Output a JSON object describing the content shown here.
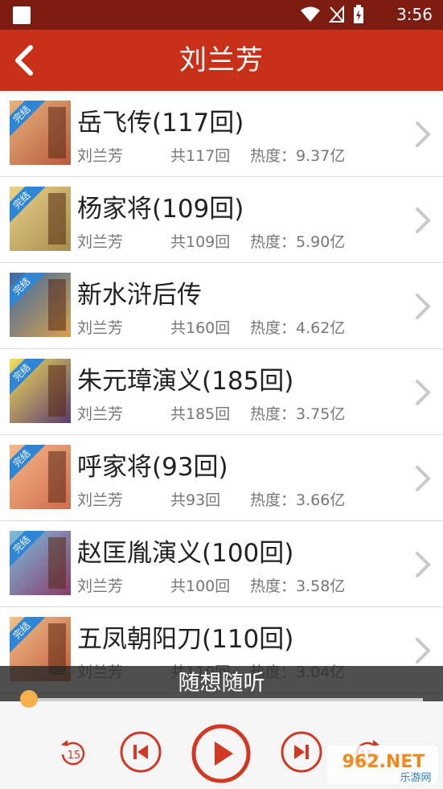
{
  "status": {
    "time": "3:56"
  },
  "header": {
    "title": "刘兰芳"
  },
  "list": [
    {
      "title": "岳飞传(117回)",
      "author": "刘兰芳",
      "count": "共117回",
      "heat": "热度：9.37亿",
      "badge": "完结"
    },
    {
      "title": "杨家将(109回)",
      "author": "刘兰芳",
      "count": "共109回",
      "heat": "热度：5.90亿",
      "badge": "完结"
    },
    {
      "title": "新水浒后传",
      "author": "刘兰芳",
      "count": "共160回",
      "heat": "热度：4.62亿",
      "badge": "完结"
    },
    {
      "title": "朱元璋演义(185回)",
      "author": "刘兰芳",
      "count": "共185回",
      "heat": "热度：3.75亿",
      "badge": "完结"
    },
    {
      "title": "呼家将(93回)",
      "author": "刘兰芳",
      "count": "共93回",
      "heat": "热度：3.66亿",
      "badge": "完结"
    },
    {
      "title": "赵匡胤演义(100回)",
      "author": "刘兰芳",
      "count": "共100回",
      "heat": "热度：3.58亿",
      "badge": "完结"
    },
    {
      "title": "五凤朝阳刀(110回)",
      "author": "刘兰芳",
      "count": "共110回",
      "heat": "热度：3.04亿",
      "badge": "完结"
    }
  ],
  "player": {
    "now_playing": "随想随听",
    "progress": 0.0,
    "rewind_label": "15",
    "forward_label": "15",
    "accent_color": "#d03a25"
  },
  "watermark": {
    "text": "962.NET",
    "sub": "乐游网"
  }
}
